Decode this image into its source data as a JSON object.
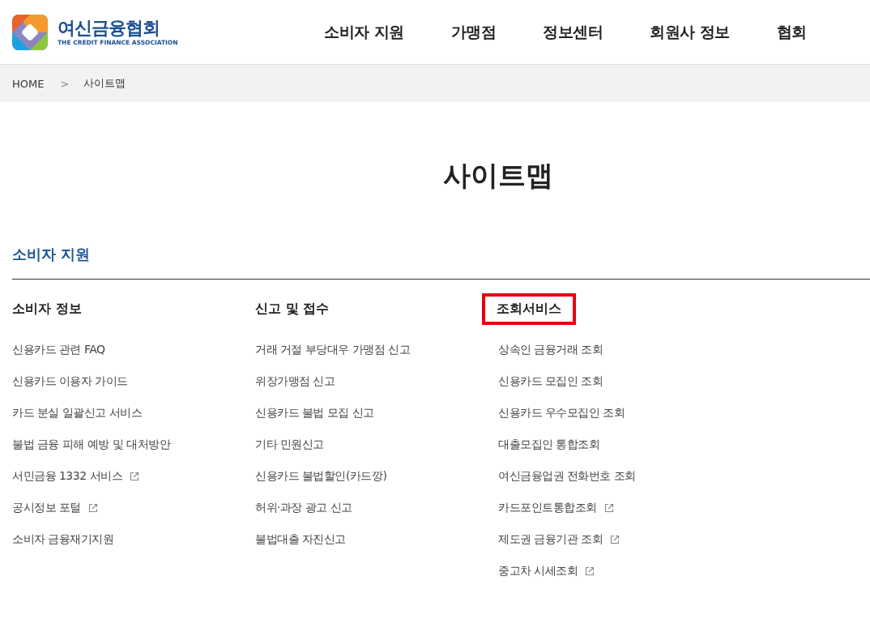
{
  "logo": {
    "name": "여신금융협회",
    "subtitle": "THE CREDIT FINANCE ASSOCIATION"
  },
  "nav": [
    "소비자 지원",
    "가맹점",
    "정보센터",
    "회원사 정보",
    "협회"
  ],
  "breadcrumb": {
    "home": "HOME",
    "separator": ">",
    "current": "사이트맵"
  },
  "page_title": "사이트맵",
  "section": {
    "title": "소비자 지원",
    "columns": [
      {
        "heading": "소비자 정보",
        "highlighted": false,
        "links": [
          {
            "label": "신용카드 관련 FAQ",
            "external": false
          },
          {
            "label": "신용카드 이용자 가이드",
            "external": false
          },
          {
            "label": "카드 분실 일괄신고 서비스",
            "external": false
          },
          {
            "label": "불법 금융 피해 예방 및 대처방안",
            "external": false
          },
          {
            "label": "서민금융 1332 서비스",
            "external": true
          },
          {
            "label": "공시정보 포털",
            "external": true
          },
          {
            "label": "소비자 금융재기지원",
            "external": false
          }
        ]
      },
      {
        "heading": "신고 및 접수",
        "highlighted": false,
        "links": [
          {
            "label": "거래 거절 부당대우 가맹점 신고",
            "external": false
          },
          {
            "label": "위장가맹점 신고",
            "external": false
          },
          {
            "label": "신용카드 불법 모집 신고",
            "external": false
          },
          {
            "label": "기타 민원신고",
            "external": false
          },
          {
            "label": "신용카드 불법할인(카드깡)",
            "external": false
          },
          {
            "label": "허위·과장 광고 신고",
            "external": false
          },
          {
            "label": "불법대출 자진신고",
            "external": false
          }
        ]
      },
      {
        "heading": "조회서비스",
        "highlighted": true,
        "links": [
          {
            "label": "상속인 금융거래 조회",
            "external": false
          },
          {
            "label": "신용카드 모집인 조회",
            "external": false
          },
          {
            "label": "신용카드 우수모집인 조회",
            "external": false
          },
          {
            "label": "대출모집인 통합조회",
            "external": false
          },
          {
            "label": "여신금융업권 전화번호 조회",
            "external": false
          },
          {
            "label": "카드포인트통합조회",
            "external": true
          },
          {
            "label": "제도권 금융기관 조회",
            "external": true
          },
          {
            "label": "중고차 시세조회",
            "external": true
          }
        ]
      }
    ]
  }
}
